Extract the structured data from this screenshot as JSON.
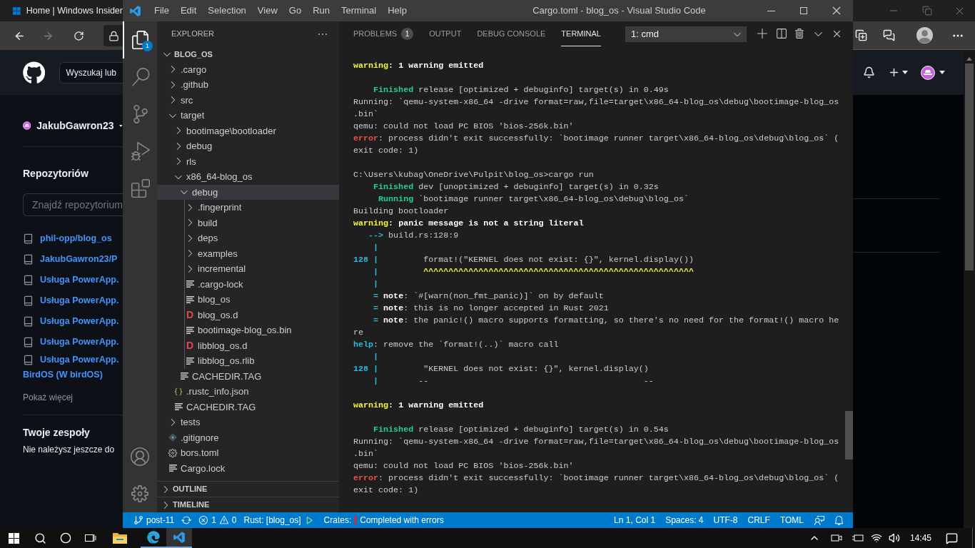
{
  "browser": {
    "tab_title": "Home | Windows Insider",
    "github": {
      "search": {
        "placeholder": "Wyszukaj lub"
      },
      "user": "JakubGawron23",
      "repos_heading": "Repozytoriów",
      "repo_search": {
        "placeholder": "Znajdź repozytorium"
      },
      "repos": [
        {
          "name": "phil-opp/blog_os"
        },
        {
          "name": "JakubGawron23/P"
        },
        {
          "name": "Usługa PowerApp."
        },
        {
          "name": "Usługa PowerApp."
        },
        {
          "name": "Usługa PowerApp."
        },
        {
          "name": "Usługa PowerApp."
        },
        {
          "name": "Usługa PowerApp.",
          "wrap": "BirdOS (W birdOS)"
        }
      ],
      "show_more": "Pokaż więcej",
      "teams_heading": "Twoje zespoły",
      "teams_text": "Nie należysz jeszcze do"
    }
  },
  "vscode": {
    "menu": [
      "File",
      "Edit",
      "Selection",
      "View",
      "Go",
      "Run",
      "Terminal",
      "Help"
    ],
    "title": "Cargo.toml - blog_os - Visual Studio Code",
    "activity": [
      {
        "kind": "explorer",
        "selected": true,
        "badge": "1"
      },
      {
        "kind": "search",
        "selected": false
      },
      {
        "kind": "scm",
        "selected": false
      },
      {
        "kind": "debug",
        "selected": false
      },
      {
        "kind": "extensions",
        "selected": false
      }
    ],
    "explorer": {
      "title": "EXPLORER",
      "root": {
        "label": "BLOG_OS",
        "expanded": true,
        "children": [
          {
            "label": ".cargo",
            "kind": "folder",
            "expanded": false,
            "selected": false
          },
          {
            "label": ".github",
            "kind": "folder",
            "expanded": false,
            "selected": false
          },
          {
            "label": "src",
            "kind": "folder",
            "expanded": false,
            "selected": false
          },
          {
            "label": "target",
            "kind": "folder",
            "expanded": true,
            "selected": false,
            "children": [
              {
                "label": "bootimage\\bootloader",
                "kind": "folder",
                "expanded": false,
                "selected": false
              },
              {
                "label": "debug",
                "kind": "folder",
                "expanded": false,
                "selected": false
              },
              {
                "label": "rls",
                "kind": "folder",
                "expanded": false,
                "selected": false
              },
              {
                "label": "x86_64-blog_os",
                "kind": "folder",
                "expanded": true,
                "selected": false,
                "children": [
                  {
                    "label": "debug",
                    "kind": "folder",
                    "expanded": true,
                    "selected": true,
                    "children": [
                      {
                        "label": ".fingerprint",
                        "kind": "folder",
                        "expanded": false,
                        "selected": false
                      },
                      {
                        "label": "build",
                        "kind": "folder",
                        "expanded": false,
                        "selected": false
                      },
                      {
                        "label": "deps",
                        "kind": "folder",
                        "expanded": false,
                        "selected": false
                      },
                      {
                        "label": "examples",
                        "kind": "folder",
                        "expanded": false,
                        "selected": false
                      },
                      {
                        "label": "incremental",
                        "kind": "folder",
                        "expanded": false,
                        "selected": false
                      },
                      {
                        "label": ".cargo-lock",
                        "kind": "file",
                        "selected": false
                      },
                      {
                        "label": "blog_os",
                        "kind": "file",
                        "selected": false
                      },
                      {
                        "label": "blog_os.d",
                        "kind": "dep",
                        "glyph": "D",
                        "selected": false
                      },
                      {
                        "label": "bootimage-blog_os.bin",
                        "kind": "file",
                        "selected": false
                      },
                      {
                        "label": "libblog_os.d",
                        "kind": "dep",
                        "glyph": "D",
                        "selected": false
                      },
                      {
                        "label": "libblog_os.rlib",
                        "kind": "file",
                        "selected": false
                      }
                    ]
                  },
                  {
                    "label": "CACHEDIR.TAG",
                    "kind": "file",
                    "selected": false
                  }
                ]
              },
              {
                "label": ".rustc_info.json",
                "kind": "json",
                "selected": false
              },
              {
                "label": "CACHEDIR.TAG",
                "kind": "file",
                "selected": false
              }
            ]
          },
          {
            "label": "tests",
            "kind": "folder",
            "expanded": false,
            "selected": false
          },
          {
            "label": ".gitignore",
            "kind": "git",
            "selected": false
          },
          {
            "label": "bors.toml",
            "kind": "gear",
            "selected": false
          },
          {
            "label": "Cargo.lock",
            "kind": "file",
            "selected": false
          }
        ]
      },
      "sections": [
        {
          "label": "OUTLINE",
          "expanded": false
        },
        {
          "label": "TIMELINE",
          "expanded": false
        }
      ]
    },
    "panel": {
      "tabs": [
        {
          "label": "PROBLEMS",
          "badge": "1",
          "selected": false
        },
        {
          "label": "OUTPUT",
          "selected": false
        },
        {
          "label": "DEBUG CONSOLE",
          "selected": false
        },
        {
          "label": "TERMINAL",
          "selected": true
        }
      ],
      "terminal_select": "1: cmd",
      "blocks": [
        {
          "lines": [
            {
              "segments": [
                {
                  "kind": "warning",
                  "text": "warning"
                },
                {
                  "kind": "bold",
                  "text": ": 1 warning emitted"
                }
              ]
            }
          ]
        },
        {
          "lines": [
            {
              "segments": [
                {
                  "kind": "success",
                  "text": "    Finished"
                },
                {
                  "kind": "plain",
                  "text": " release [optimized + debuginfo] target(s) in 0.49s"
                }
              ]
            },
            {
              "segments": [
                {
                  "kind": "plain",
                  "text": "Running: `qemu-system-x86_64 -drive format=raw,file=target\\x86_64-blog_os\\debug\\bootimage-blog_os"
                }
              ]
            },
            {
              "segments": [
                {
                  "kind": "plain",
                  "text": ".bin`"
                }
              ]
            },
            {
              "segments": [
                {
                  "kind": "plain",
                  "text": "qemu: could not load PC BIOS 'bios-256k.bin'"
                }
              ]
            },
            {
              "segments": [
                {
                  "kind": "error",
                  "text": "error"
                },
                {
                  "kind": "plain",
                  "text": ": process didn't exit successfully: `bootimage runner target\\x86_64-blog_os\\debug\\blog_os` ("
                }
              ]
            },
            {
              "segments": [
                {
                  "kind": "plain",
                  "text": "exit code: 1)"
                }
              ]
            }
          ]
        },
        {
          "lines": [
            {
              "segments": [
                {
                  "kind": "plain",
                  "text": "C:\\Users\\kubag\\OneDrive\\Pulpit\\blog_os>cargo run"
                }
              ]
            },
            {
              "segments": [
                {
                  "kind": "success",
                  "text": "    Finished"
                },
                {
                  "kind": "plain",
                  "text": " dev [unoptimized + debuginfo] target(s) in 0.32s"
                }
              ]
            },
            {
              "segments": [
                {
                  "kind": "success",
                  "text": "     Running"
                },
                {
                  "kind": "plain",
                  "text": " `bootimage runner target\\x86_64-blog_os\\debug\\blog_os`"
                }
              ]
            },
            {
              "segments": [
                {
                  "kind": "plain",
                  "text": "Building bootloader"
                }
              ]
            },
            {
              "segments": [
                {
                  "kind": "warning",
                  "text": "warning"
                },
                {
                  "kind": "bold",
                  "text": ": panic message is not a string literal"
                }
              ]
            },
            {
              "segments": [
                {
                  "kind": "info",
                  "text": "   -->"
                },
                {
                  "kind": "plain",
                  "text": " build.rs:128:9"
                }
              ]
            },
            {
              "segments": [
                {
                  "kind": "info",
                  "text": "    |"
                }
              ]
            },
            {
              "segments": [
                {
                  "kind": "info",
                  "text": "128 |"
                },
                {
                  "kind": "plain",
                  "text": "         format!(\"KERNEL does not exist: {}\", kernel.display())"
                }
              ]
            },
            {
              "segments": [
                {
                  "kind": "info",
                  "text": "    |"
                },
                {
                  "kind": "caret",
                  "text": "         ^^^^^^^^^^^^^^^^^^^^^^^^^^^^^^^^^^^^^^^^^^^^^^^^^^^^^^"
                }
              ]
            },
            {
              "segments": [
                {
                  "kind": "info",
                  "text": "    |"
                }
              ]
            },
            {
              "segments": [
                {
                  "kind": "info",
                  "text": "    ="
                },
                {
                  "kind": "bold",
                  "text": " note"
                },
                {
                  "kind": "plain",
                  "text": ": `#[warn(non_fmt_panic)]` on by default"
                }
              ]
            },
            {
              "segments": [
                {
                  "kind": "info",
                  "text": "    ="
                },
                {
                  "kind": "bold",
                  "text": " note"
                },
                {
                  "kind": "plain",
                  "text": ": this is no longer accepted in Rust 2021"
                }
              ]
            },
            {
              "segments": [
                {
                  "kind": "info",
                  "text": "    ="
                },
                {
                  "kind": "bold",
                  "text": " note"
                },
                {
                  "kind": "plain",
                  "text": ": the panic!() macro supports formatting, so there's no need for the format!() macro he"
                }
              ]
            },
            {
              "segments": [
                {
                  "kind": "plain",
                  "text": "re"
                }
              ]
            },
            {
              "segments": [
                {
                  "kind": "info",
                  "text": "help"
                },
                {
                  "kind": "plain",
                  "text": ": remove the `format!(..)` macro call"
                }
              ]
            },
            {
              "segments": [
                {
                  "kind": "info",
                  "text": "    |"
                }
              ]
            },
            {
              "segments": [
                {
                  "kind": "info",
                  "text": "128 |"
                },
                {
                  "kind": "plain",
                  "text": "         \"KERNEL does not exist: {}\", kernel.display()"
                }
              ]
            },
            {
              "segments": [
                {
                  "kind": "info",
                  "text": "    |"
                },
                {
                  "kind": "plain",
                  "text": "        --                                           --"
                }
              ]
            }
          ]
        },
        {
          "lines": [
            {
              "segments": [
                {
                  "kind": "warning",
                  "text": "warning"
                },
                {
                  "kind": "bold",
                  "text": ": 1 warning emitted"
                }
              ]
            }
          ]
        },
        {
          "lines": [
            {
              "segments": [
                {
                  "kind": "success",
                  "text": "    Finished"
                },
                {
                  "kind": "plain",
                  "text": " release [optimized + debuginfo] target(s) in 0.54s"
                }
              ]
            },
            {
              "segments": [
                {
                  "kind": "plain",
                  "text": "Running: `qemu-system-x86_64 -drive format=raw,file=target\\x86_64-blog_os\\debug\\bootimage-blog_os"
                }
              ]
            },
            {
              "segments": [
                {
                  "kind": "plain",
                  "text": ".bin`"
                }
              ]
            },
            {
              "segments": [
                {
                  "kind": "plain",
                  "text": "qemu: could not load PC BIOS 'bios-256k.bin'"
                }
              ]
            },
            {
              "segments": [
                {
                  "kind": "error",
                  "text": "error"
                },
                {
                  "kind": "plain",
                  "text": ": process didn't exit successfully: `bootimage runner target\\x86_64-blog_os\\debug\\blog_os` ("
                }
              ]
            },
            {
              "segments": [
                {
                  "kind": "plain",
                  "text": "exit code: 1)"
                }
              ]
            }
          ]
        }
      ]
    },
    "status_bar": {
      "branch": "post-11",
      "errors": "1",
      "warnings": "0",
      "rust": "Rust: [blog_os]",
      "crates_label": "Crates:",
      "crates_status": "Completed with errors",
      "right": [
        "Ln 1, Col 1",
        "Spaces: 4",
        "UTF-8",
        "CRLF",
        "TOML"
      ]
    }
  },
  "taskbar": {
    "time": "14:45"
  }
}
